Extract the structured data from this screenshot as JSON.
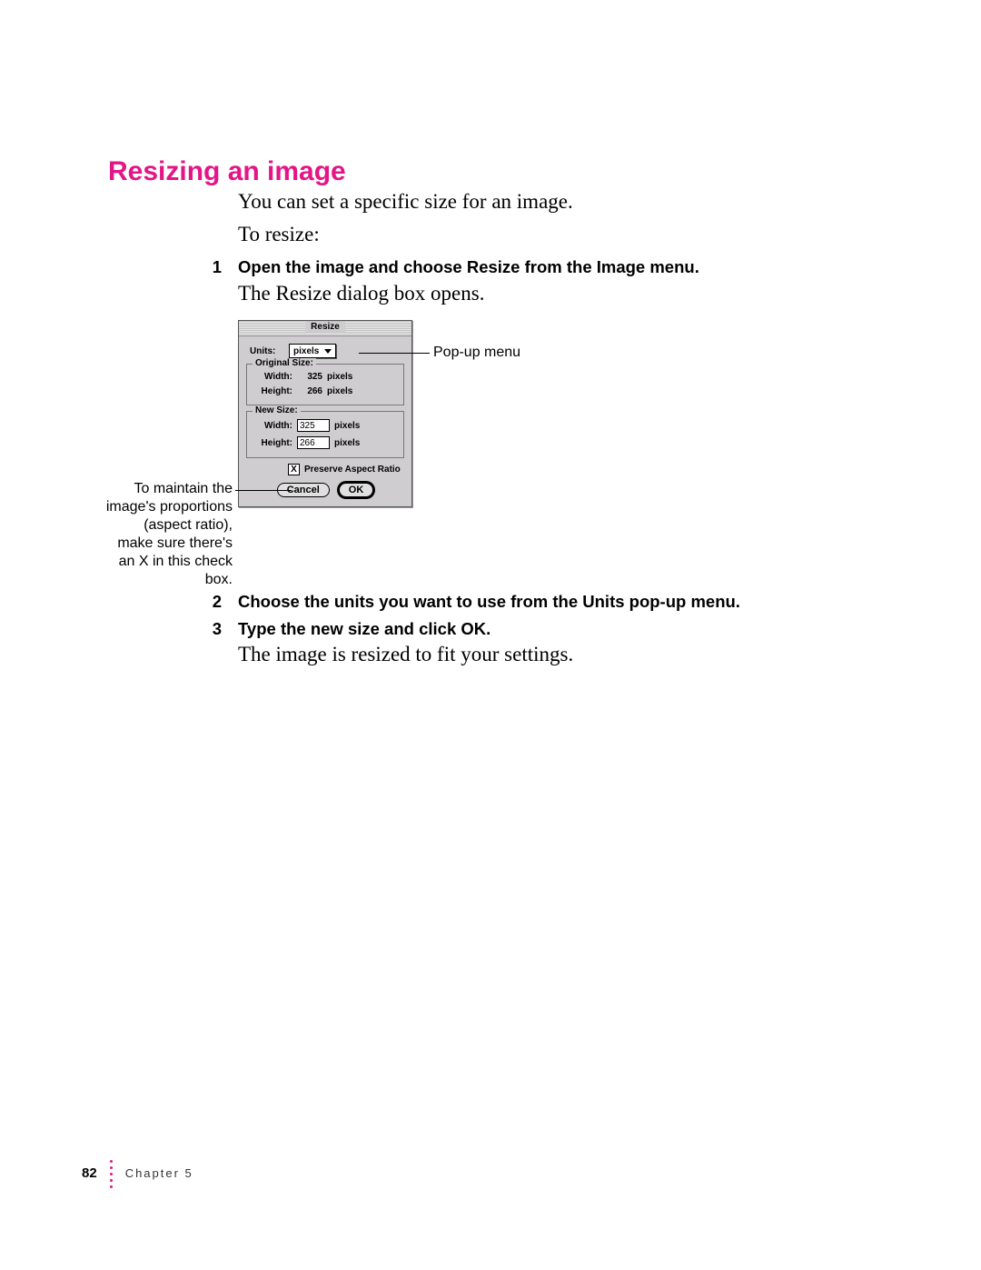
{
  "heading": "Resizing an image",
  "intro1": "You can set a specific size for an image.",
  "intro2": "To resize:",
  "steps": {
    "s1_num": "1",
    "s1_text": "Open the image and choose Resize from the Image menu.",
    "s1_follow": "The Resize dialog box opens.",
    "s2_num": "2",
    "s2_text": "Choose the units you want to use from the Units pop-up menu.",
    "s3_num": "3",
    "s3_text": "Type the new size and click OK.",
    "s3_follow": "The image is resized to fit your settings."
  },
  "dialog": {
    "title": "Resize",
    "units_label": "Units:",
    "units_value": "pixels",
    "original_legend": "Original Size:",
    "new_legend": "New Size:",
    "width_label": "Width:",
    "height_label": "Height:",
    "orig_width": "325",
    "orig_height": "266",
    "orig_unit": "pixels",
    "new_width": "325",
    "new_height": "266",
    "new_unit": "pixels",
    "preserve_check": "X",
    "preserve_label": "Preserve Aspect Ratio",
    "cancel": "Cancel",
    "ok": "OK"
  },
  "callouts": {
    "popup": "Pop-up menu",
    "aspect": "To maintain the image's proportions (aspect ratio), make sure there's an X in this check box."
  },
  "footer": {
    "page": "82",
    "chapter": "Chapter 5"
  }
}
